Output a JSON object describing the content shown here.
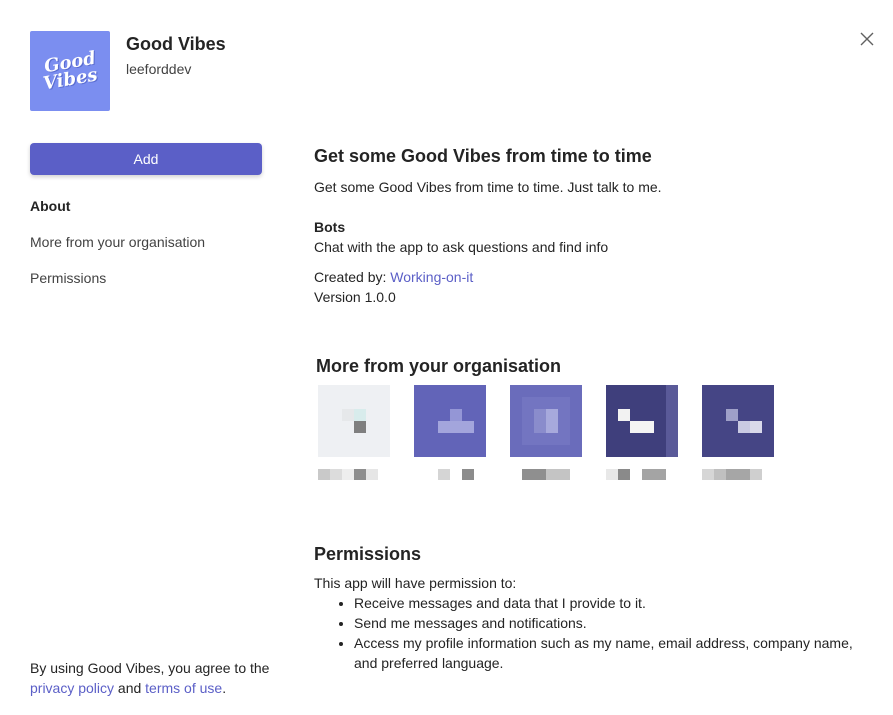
{
  "app": {
    "name": "Good Vibes",
    "developer": "leeforddev",
    "logo_text_line1": "Good",
    "logo_text_line2": "Vibes",
    "logo_color": "#7b8ef0"
  },
  "actions": {
    "add_label": "Add",
    "add_color": "#5b5fc7",
    "close_icon": "close-icon"
  },
  "nav": {
    "items": [
      {
        "label": "About",
        "active": true
      },
      {
        "label": "More from your organisation",
        "active": false
      },
      {
        "label": "Permissions",
        "active": false
      }
    ]
  },
  "about": {
    "headline": "Get some Good Vibes from time to time",
    "description": "Get some Good Vibes from time to time. Just talk to me.",
    "bots_heading": "Bots",
    "bots_text": "Chat with the app to ask questions and find info",
    "created_by_label": "Created by:",
    "created_by_link": "Working-on-it",
    "version": "Version 1.0.0"
  },
  "more": {
    "title": "More from your organisation",
    "tiles": [
      {
        "name": "pixelated-app-1",
        "bg": "#eef0f3"
      },
      {
        "name": "pixelated-app-2",
        "bg": "#6264b8"
      },
      {
        "name": "pixelated-app-3",
        "bg": "#6a6cbb"
      },
      {
        "name": "pixelated-app-4",
        "bg": "#3f3f7c"
      },
      {
        "name": "pixelated-app-5",
        "bg": "#454585"
      }
    ]
  },
  "permissions": {
    "title": "Permissions",
    "intro": "This app will have permission to:",
    "items": [
      "Receive messages and data that I provide to it.",
      "Send me messages and notifications.",
      "Access my profile information such as my name, email address, company name, and preferred language."
    ]
  },
  "consent": {
    "prefix": "By using Good Vibes, you agree to the",
    "privacy": "privacy policy",
    "and": "and",
    "terms": "terms of use",
    "suffix": "."
  },
  "colors": {
    "accent": "#5b5fc7",
    "text": "#242424"
  }
}
